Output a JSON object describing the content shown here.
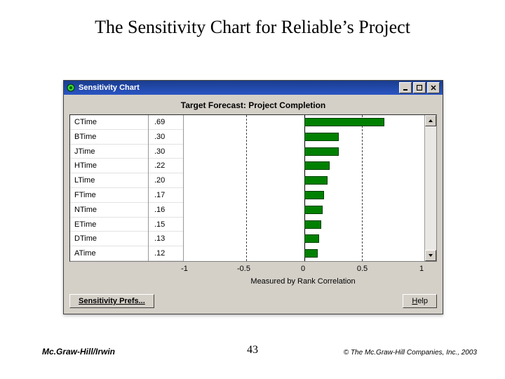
{
  "slide": {
    "title": "The Sensitivity Chart for Reliable’s Project",
    "page_number": "43",
    "footer_left": "Mc.Graw-Hill/Irwin",
    "footer_right": "© The Mc.Graw-Hill Companies, Inc., 2003"
  },
  "window": {
    "title": "Sensitivity Chart",
    "subtitle": "Target Forecast:  Project Completion",
    "prefs_button": "Sensitivity Prefs...",
    "help_button": "Help",
    "help_key": "H"
  },
  "axis": {
    "label": "Measured by Rank Correlation",
    "ticks": [
      "-1",
      "-0.5",
      "0",
      "0.5",
      "1"
    ]
  },
  "chart_data": {
    "type": "bar",
    "title": "Target Forecast: Project Completion",
    "xlabel": "Measured by Rank Correlation",
    "xlim": [
      -1,
      1
    ],
    "categories": [
      "CTime",
      "BTime",
      "JTime",
      "HTime",
      "LTime",
      "FTime",
      "NTime",
      "ETime",
      "DTime",
      "ATime"
    ],
    "values": [
      0.69,
      0.3,
      0.3,
      0.22,
      0.2,
      0.17,
      0.16,
      0.15,
      0.13,
      0.12
    ],
    "display": [
      ".69",
      ".30",
      ".30",
      ".22",
      ".20",
      ".17",
      ".16",
      ".15",
      ".13",
      ".12"
    ]
  }
}
